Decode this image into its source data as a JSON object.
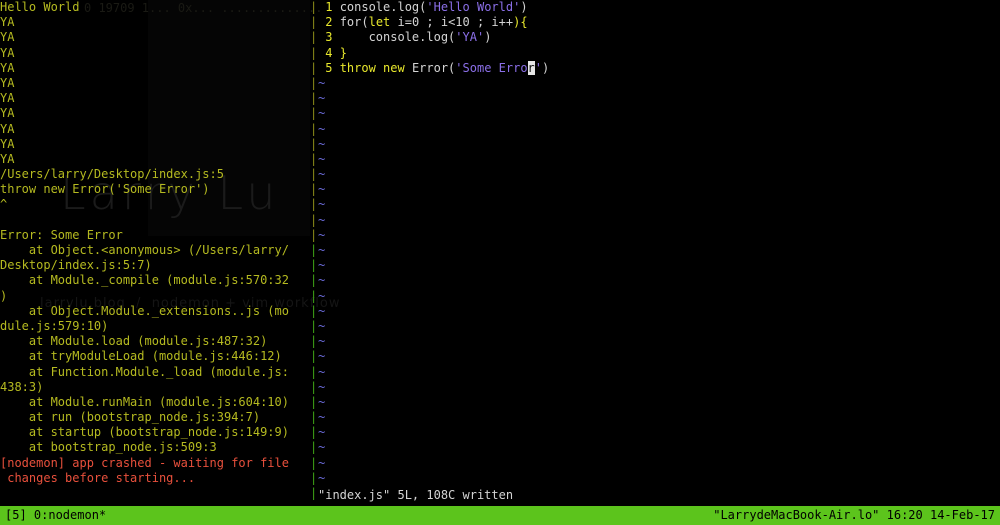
{
  "window": {
    "title": "tmux — nodemon / vim index.js",
    "columns": 138,
    "rows": 34,
    "background": "#000000"
  },
  "watermark": {
    "main": "Larry Lu",
    "sub": "larrylu.blog  /  nodemon + vim workflow",
    "top": "0 19709 1... 0x... .............."
  },
  "colors": {
    "stdout_yellow": "#b5ba20",
    "error_red": "#e8503c",
    "vim_linenumber": "#e8e82c",
    "vim_keyword": "#e8e82c",
    "vim_string": "#8b6fe8",
    "vim_text": "#d4d4d4",
    "vim_tilde": "#6a6ad8",
    "divider_olive": "#8a8a18",
    "divider_green": "#3ea317",
    "status_bg": "#5cc41c",
    "status_fg": "#000000",
    "cursor_bg": "#e6e6e6"
  },
  "left_pane": {
    "name": "nodemon-output-pane",
    "lines": [
      {
        "text": "Hello World",
        "color": "yellow"
      },
      {
        "text": "YA",
        "color": "yellow"
      },
      {
        "text": "YA",
        "color": "yellow"
      },
      {
        "text": "YA",
        "color": "yellow"
      },
      {
        "text": "YA",
        "color": "yellow"
      },
      {
        "text": "YA",
        "color": "yellow"
      },
      {
        "text": "YA",
        "color": "yellow"
      },
      {
        "text": "YA",
        "color": "yellow"
      },
      {
        "text": "YA",
        "color": "yellow"
      },
      {
        "text": "YA",
        "color": "yellow"
      },
      {
        "text": "YA",
        "color": "yellow"
      },
      {
        "text": "/Users/larry/Desktop/index.js:5",
        "color": "yellow"
      },
      {
        "text": "throw new Error('Some Error')",
        "color": "yellow"
      },
      {
        "text": "^",
        "color": "yellow"
      },
      {
        "text": "",
        "color": "yellow"
      },
      {
        "text": "Error: Some Error",
        "color": "yellow"
      },
      {
        "text": "    at Object.<anonymous> (/Users/larry/",
        "color": "yellow"
      },
      {
        "text": "Desktop/index.js:5:7)",
        "color": "yellow"
      },
      {
        "text": "    at Module._compile (module.js:570:32",
        "color": "yellow"
      },
      {
        "text": ")",
        "color": "yellow"
      },
      {
        "text": "    at Object.Module._extensions..js (mo",
        "color": "yellow"
      },
      {
        "text": "dule.js:579:10)",
        "color": "yellow"
      },
      {
        "text": "    at Module.load (module.js:487:32)",
        "color": "yellow"
      },
      {
        "text": "    at tryModuleLoad (module.js:446:12)",
        "color": "yellow"
      },
      {
        "text": "    at Function.Module._load (module.js:",
        "color": "yellow"
      },
      {
        "text": "438:3)",
        "color": "yellow"
      },
      {
        "text": "    at Module.runMain (module.js:604:10)",
        "color": "yellow"
      },
      {
        "text": "    at run (bootstrap_node.js:394:7)",
        "color": "yellow"
      },
      {
        "text": "    at startup (bootstrap_node.js:149:9)",
        "color": "yellow"
      },
      {
        "text": "    at bootstrap_node.js:509:3",
        "color": "yellow"
      },
      {
        "text": "[nodemon] app crashed - waiting for file",
        "color": "red"
      },
      {
        "text": " changes before starting...",
        "color": "red"
      },
      {
        "text": "",
        "color": "yellow"
      }
    ]
  },
  "divider": {
    "name": "pane-divider",
    "glyph": "|",
    "olive_rows": 16,
    "total_rows": 33
  },
  "right_pane": {
    "name": "vim-editor-pane",
    "filename": "index.js",
    "code_lines": [
      {
        "number": "1",
        "tokens": [
          {
            "t": "console.log(",
            "c": "white"
          },
          {
            "t": "'Hello World'",
            "c": "violet"
          },
          {
            "t": ")",
            "c": "white"
          }
        ]
      },
      {
        "number": "2",
        "tokens": [
          {
            "t": "for(",
            "c": "white"
          },
          {
            "t": "let",
            "c": "keyword"
          },
          {
            "t": " i=0 ; i<10 ; i++",
            "c": "white"
          },
          {
            "t": "){",
            "c": "keyword"
          }
        ]
      },
      {
        "number": "3",
        "tokens": [
          {
            "t": "    console.log(",
            "c": "white"
          },
          {
            "t": "'YA'",
            "c": "violet"
          },
          {
            "t": ")",
            "c": "white"
          }
        ]
      },
      {
        "number": "4",
        "tokens": [
          {
            "t": "}",
            "c": "keyword"
          }
        ]
      },
      {
        "number": "5",
        "tokens": [
          {
            "t": "throw new ",
            "c": "keyword"
          },
          {
            "t": "Error(",
            "c": "white"
          },
          {
            "t": "'Some Erro",
            "c": "violet"
          },
          {
            "t": "r",
            "c": "cursor"
          },
          {
            "t": "'",
            "c": "violet"
          },
          {
            "t": ")",
            "c": "white"
          }
        ]
      }
    ],
    "empty_line_marker": "~",
    "empty_line_count": 27,
    "message_line": "\"index.js\" 5L, 108C written"
  },
  "status_bar": {
    "name": "tmux-status-bar",
    "left": "[5] 0:nodemon*",
    "right": "\"LarrydeMacBook-Air.lo\" 16:20 14-Feb-17"
  }
}
